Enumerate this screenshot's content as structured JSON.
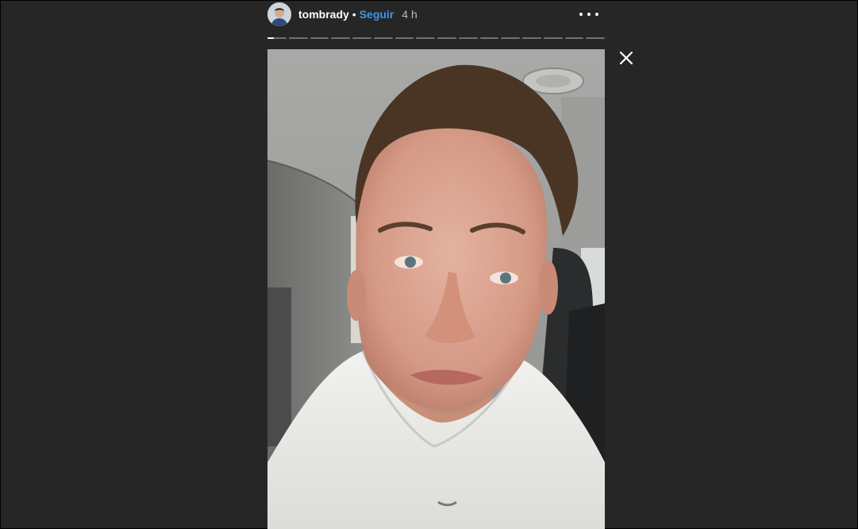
{
  "story": {
    "username": "tombrady",
    "separator": "•",
    "follow_label": "Seguir",
    "timestamp": "4 h",
    "progress": {
      "segments": 16,
      "current_index": 0,
      "current_fraction": 0.35
    }
  },
  "icons": {
    "more": "more-options-icon",
    "close": "close-icon"
  },
  "colors": {
    "background": "#262626",
    "follow": "#3897f0",
    "username": "#ffffff"
  }
}
